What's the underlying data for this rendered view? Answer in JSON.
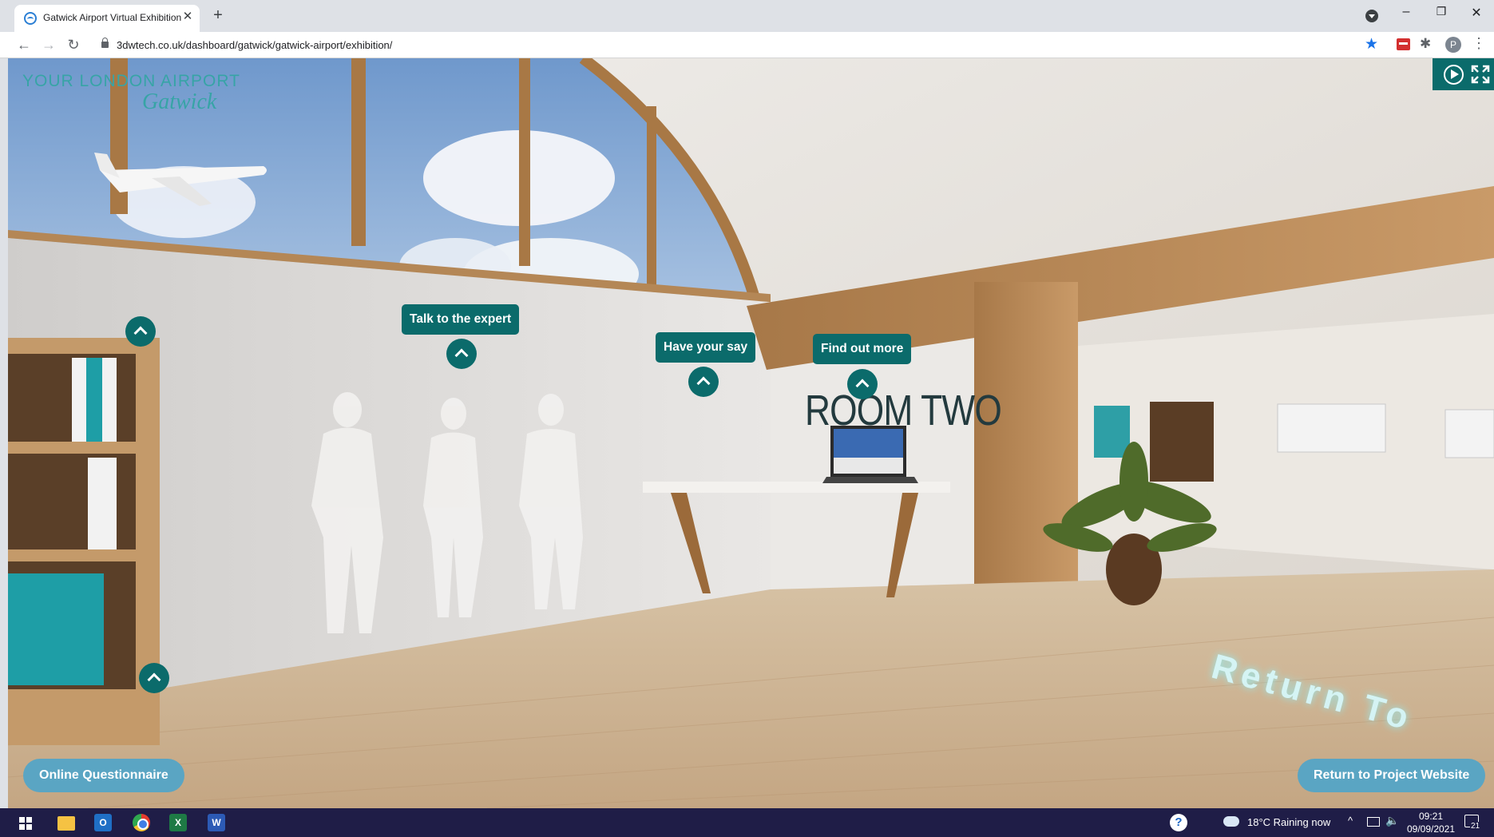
{
  "browser": {
    "tab_title": "Gatwick Airport Virtual Exhibition",
    "tab_close": "✕",
    "new_tab": "+",
    "url": "3dwtech.co.uk/dashboard/gatwick/gatwick-airport/exhibition/",
    "avatar_letter": "P",
    "back": "←",
    "forward": "→",
    "reload": "↻",
    "menu": "⋮",
    "bookmark_star": "★",
    "extensions": "✱",
    "window": {
      "minimize": "–",
      "restore": "❐",
      "close": "✕"
    }
  },
  "exhibition": {
    "logo": {
      "line1": "YOUR LONDON AIRPORT",
      "line2": "Gatwick"
    },
    "room_sign": "ROOM TWO",
    "floor_text": "Return To",
    "hotspots": [
      {
        "label": "Talk to the expert"
      },
      {
        "label": "Have your say"
      },
      {
        "label": "Find out more"
      }
    ],
    "buttons": {
      "questionnaire": "Online Questionnaire",
      "return": "Return to Project Website"
    },
    "accent": "#0b6b6b",
    "pill_color": "#5aa5c3"
  },
  "taskbar": {
    "apps": [
      "start",
      "file-explorer",
      "outlook",
      "chrome",
      "excel",
      "word"
    ],
    "outlook_letter": "O",
    "excel_letter": "X",
    "word_letter": "W",
    "help": "?",
    "weather": "18°C  Raining now",
    "tray_chevron": "^",
    "volume": "🔈",
    "time": "09:21",
    "date": "09/09/2021",
    "notifications": "21"
  }
}
